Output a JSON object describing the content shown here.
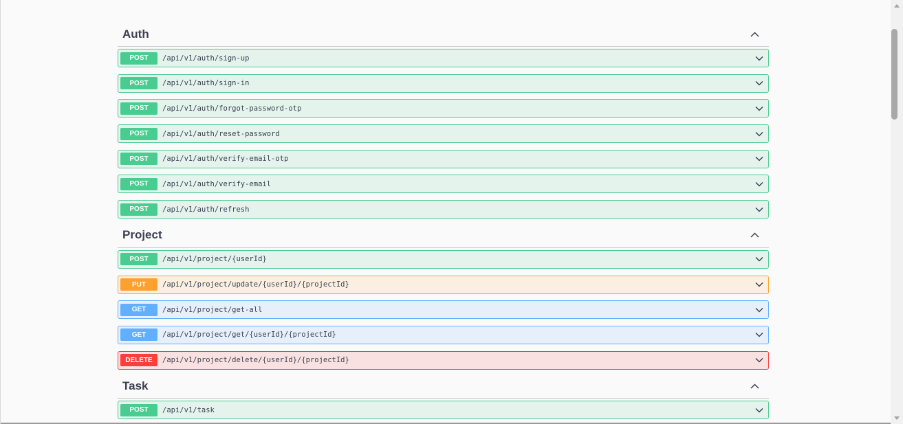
{
  "sections": [
    {
      "name": "Auth",
      "ops": [
        {
          "method": "POST",
          "path": "/api/v1/auth/sign-up"
        },
        {
          "method": "POST",
          "path": "/api/v1/auth/sign-in"
        },
        {
          "method": "POST",
          "path": "/api/v1/auth/forgot-password-otp"
        },
        {
          "method": "POST",
          "path": "/api/v1/auth/reset-password"
        },
        {
          "method": "POST",
          "path": "/api/v1/auth/verify-email-otp"
        },
        {
          "method": "POST",
          "path": "/api/v1/auth/verify-email"
        },
        {
          "method": "POST",
          "path": "/api/v1/auth/refresh"
        }
      ]
    },
    {
      "name": "Project",
      "ops": [
        {
          "method": "POST",
          "path": "/api/v1/project/{userId}"
        },
        {
          "method": "PUT",
          "path": "/api/v1/project/update/{userId}/{projectId}"
        },
        {
          "method": "GET",
          "path": "/api/v1/project/get-all"
        },
        {
          "method": "GET",
          "path": "/api/v1/project/get/{userId}/{projectId}"
        },
        {
          "method": "DELETE",
          "path": "/api/v1/project/delete/{userId}/{projectId}"
        }
      ]
    },
    {
      "name": "Task",
      "ops": [
        {
          "method": "POST",
          "path": "/api/v1/task"
        }
      ]
    }
  ],
  "colors": {
    "post": "#49cc90",
    "put": "#fca130",
    "get": "#61affe",
    "delete": "#f93e3e"
  },
  "icons": {
    "collapse": "chevron-up-icon",
    "expand": "chevron-down-icon"
  }
}
